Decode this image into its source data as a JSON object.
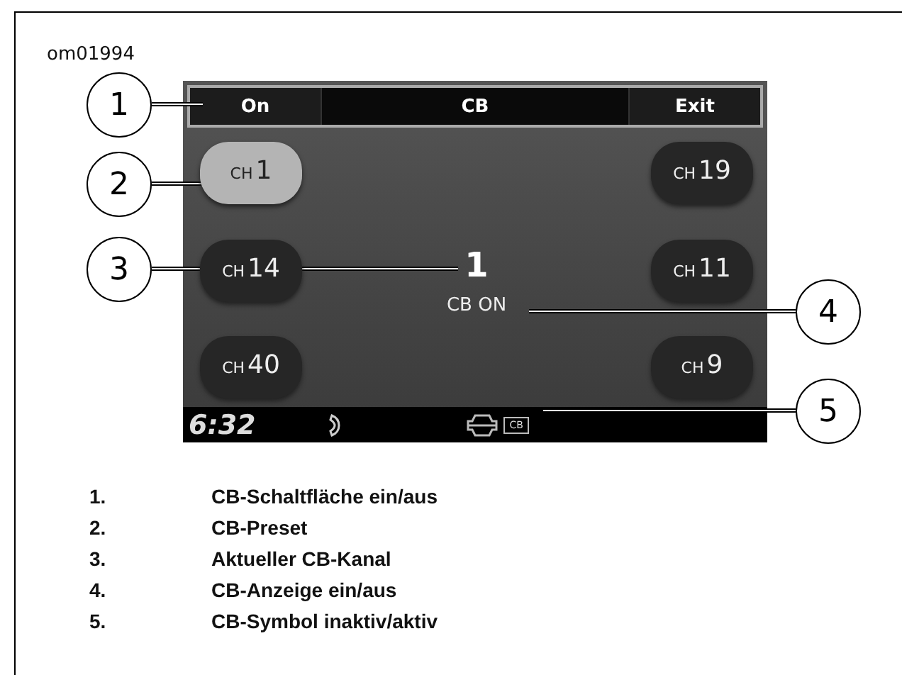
{
  "figure_id": "om01994",
  "top_bar": {
    "left_button": "On",
    "title": "CB",
    "right_button": "Exit"
  },
  "presets_left": [
    {
      "prefix": "CH",
      "number": "1",
      "selected": true
    },
    {
      "prefix": "CH",
      "number": "14",
      "selected": false
    },
    {
      "prefix": "CH",
      "number": "40",
      "selected": false
    }
  ],
  "presets_right": [
    {
      "prefix": "CH",
      "number": "19",
      "selected": false
    },
    {
      "prefix": "CH",
      "number": "11",
      "selected": false
    },
    {
      "prefix": "CH",
      "number": "9",
      "selected": false
    }
  ],
  "current_channel": "1",
  "cb_status": "CB ON",
  "status_bar": {
    "time": "6:32",
    "cb_icon_text": "CB"
  },
  "callouts": [
    "1",
    "2",
    "3",
    "4",
    "5"
  ],
  "legend": [
    {
      "number": "1.",
      "text": "CB-Schaltfläche ein/aus"
    },
    {
      "number": "2.",
      "text": "CB-Preset"
    },
    {
      "number": "3.",
      "text": "Aktueller CB-Kanal"
    },
    {
      "number": "4.",
      "text": "CB-Anzeige ein/aus"
    },
    {
      "number": "5.",
      "text": "CB-Symbol inaktiv/aktiv"
    }
  ]
}
